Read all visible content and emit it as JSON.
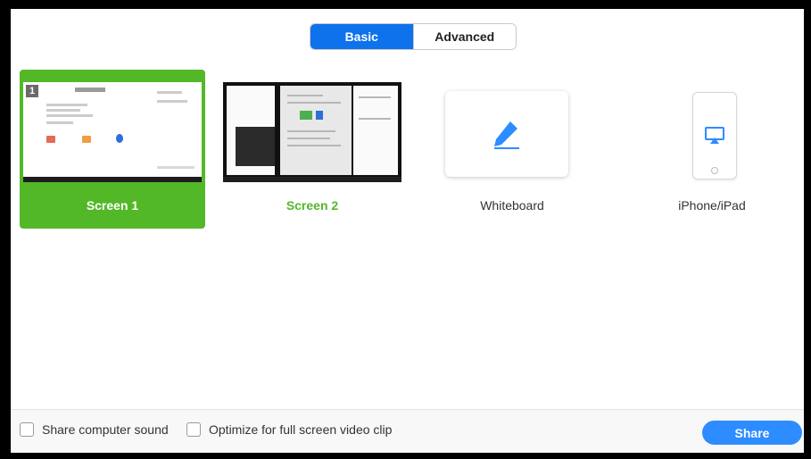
{
  "tabs": [
    {
      "label": "Basic",
      "active": true
    },
    {
      "label": "Advanced",
      "active": false
    }
  ],
  "options": {
    "screen1": {
      "label": "Screen 1",
      "number": "1",
      "selected": true
    },
    "screen2": {
      "label": "Screen 2"
    },
    "whiteboard": {
      "label": "Whiteboard",
      "icon": "pencil-icon"
    },
    "iphone": {
      "label": "iPhone/iPad",
      "icon": "airplay-icon"
    }
  },
  "footer": {
    "share_sound_label": "Share computer sound",
    "optimize_label": "Optimize for full screen video clip",
    "share_button": "Share"
  },
  "colors": {
    "accent_blue": "#0e72ed",
    "share_blue": "#2d8cff",
    "selected_green": "#53b828"
  }
}
